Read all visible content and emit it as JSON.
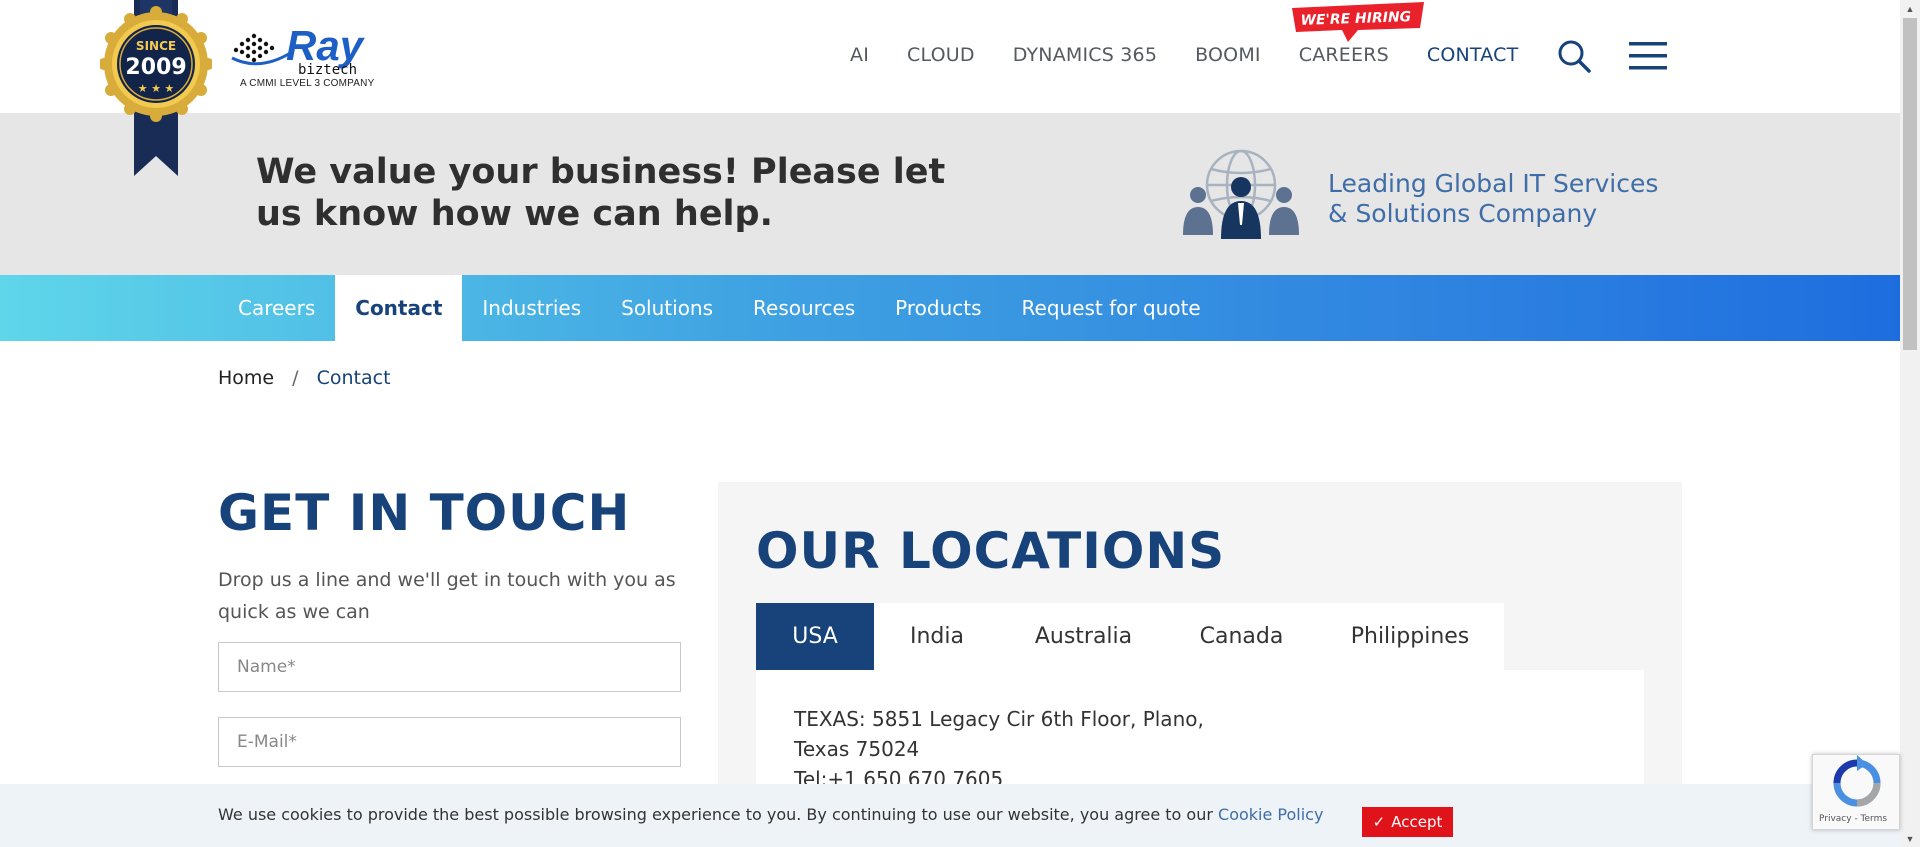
{
  "header": {
    "badge": {
      "since": "SINCE",
      "year": "2009"
    },
    "logo": {
      "name": "Ray",
      "sub": "biztech",
      "tagline": "A CMMI LEVEL 3 COMPANY"
    },
    "nav": [
      {
        "label": "AI"
      },
      {
        "label": "CLOUD"
      },
      {
        "label": "DYNAMICS 365"
      },
      {
        "label": "BOOMI"
      },
      {
        "label": "CAREERS"
      },
      {
        "label": "CONTACT"
      }
    ],
    "hiring_label": "WE'RE HIRING",
    "search_icon": "search-icon",
    "menu_icon": "hamburger-menu-icon"
  },
  "banner": {
    "title": "We value your business! Please let us know how we can help.",
    "subtitle_line1": "Leading Global IT Services",
    "subtitle_line2": "& Solutions Company"
  },
  "subnav": [
    {
      "label": "Careers"
    },
    {
      "label": "Contact"
    },
    {
      "label": "Industries"
    },
    {
      "label": "Solutions"
    },
    {
      "label": "Resources"
    },
    {
      "label": "Products"
    },
    {
      "label": "Request for quote"
    }
  ],
  "breadcrumb": {
    "home": "Home",
    "separator": "/",
    "current": "Contact"
  },
  "contact": {
    "title": "GET IN TOUCH",
    "subtitle": "Drop us a line and we'll get in touch with you as quick as we can",
    "name_placeholder": "Name*",
    "email_placeholder": "E-Mail*"
  },
  "locations": {
    "title": "OUR LOCATIONS",
    "tabs": [
      {
        "label": "USA"
      },
      {
        "label": "India"
      },
      {
        "label": "Australia"
      },
      {
        "label": "Canada"
      },
      {
        "label": "Philippines"
      }
    ],
    "address": "TEXAS: 5851 Legacy Cir 6th Floor, Plano, Texas 75024",
    "phone": "Tel:+1 650 670 7605"
  },
  "cookie": {
    "text": "We use cookies to provide the best possible browsing experience to you. By continuing to use our website, you agree to our",
    "link": "Cookie Policy",
    "accept": "Accept",
    "accept_icon": "✓"
  },
  "recaptcha": {
    "terms": "Privacy - Terms"
  },
  "colors": {
    "navy": "#17427a",
    "accent_blue": "#3f6da8",
    "subnav_start": "#5fd6ea",
    "subnav_end": "#1e6ddf",
    "banner_bg": "#e6e6e6",
    "accept_red": "#e0131a",
    "hiring_red": "#e8212b"
  }
}
